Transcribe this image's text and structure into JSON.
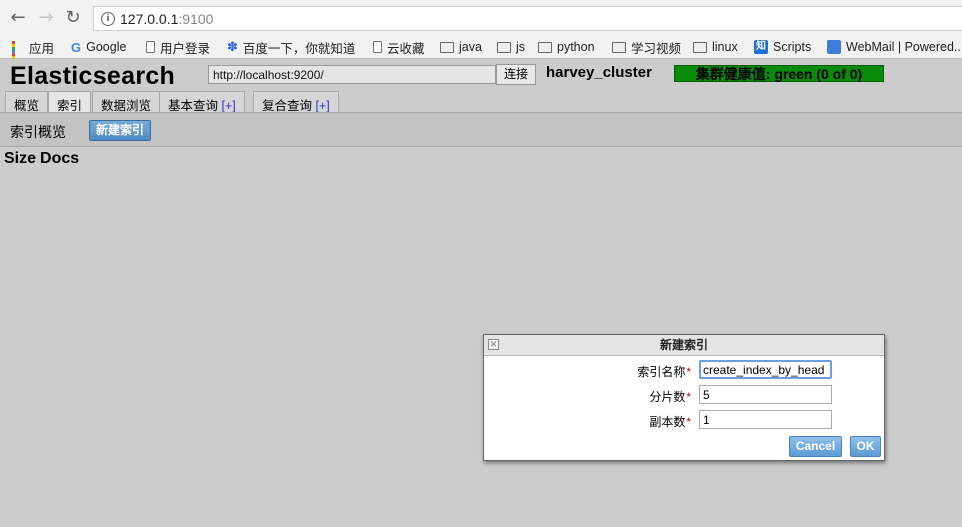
{
  "browser": {
    "url_host": "127.0.0.1",
    "url_port": ":9100",
    "bookmarks": [
      {
        "label": "应用",
        "icon": "apps-grid-icon"
      },
      {
        "label": "Google",
        "icon": "google-icon"
      },
      {
        "label": "用户登录",
        "icon": "page-icon"
      },
      {
        "label": "百度一下，你就知道",
        "icon": "baidu-paw-icon"
      },
      {
        "label": "云收藏",
        "icon": "page-icon"
      },
      {
        "label": "java",
        "icon": "folder-icon"
      },
      {
        "label": "js",
        "icon": "folder-icon"
      },
      {
        "label": "python",
        "icon": "folder-icon"
      },
      {
        "label": "学习视频",
        "icon": "folder-icon"
      },
      {
        "label": "linux",
        "icon": "folder-icon"
      },
      {
        "label": "Scripts",
        "icon": "zhihu-icon"
      },
      {
        "label": "WebMail | Powered...",
        "icon": "webmail-icon"
      }
    ]
  },
  "app": {
    "title": "Elasticsearch",
    "connect_url": "http://localhost:9200/",
    "connect_label": "连接",
    "cluster_name": "harvey_cluster",
    "health": "集群健康值: green (0 of 0)",
    "health_color": "#0a8a0a",
    "tabs": [
      {
        "label": "概览",
        "plus": ""
      },
      {
        "label": "索引",
        "plus": ""
      },
      {
        "label": "数据浏览",
        "plus": ""
      },
      {
        "label": "基本查询",
        "plus": "[+]"
      },
      {
        "label": "复合查询",
        "plus": "[+]"
      }
    ],
    "section_title": "索引概览",
    "new_index_label": "新建索引",
    "table_headers": [
      "Size",
      "Docs"
    ]
  },
  "dialog": {
    "title": "新建索引",
    "close_glyph": "×",
    "required_mark": "*",
    "fields": [
      {
        "label": "索引名称",
        "value": "create_index_by_head"
      },
      {
        "label": "分片数",
        "value": "5"
      },
      {
        "label": "副本数",
        "value": "1"
      }
    ],
    "cancel_label": "Cancel",
    "ok_label": "OK"
  }
}
